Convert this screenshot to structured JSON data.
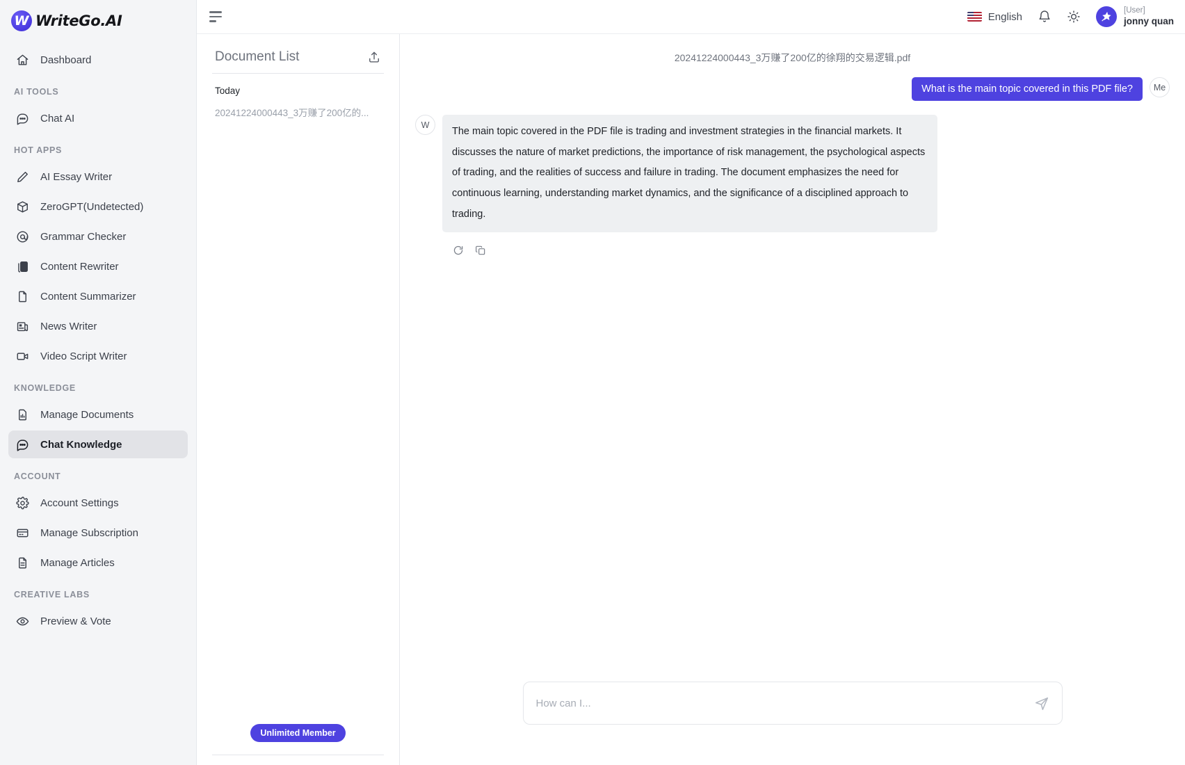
{
  "brand": {
    "mark": "W",
    "name": "WriteGo.AI",
    "logo_color": "#4e42e0"
  },
  "sidebar": {
    "groups": [
      {
        "label": "",
        "items": [
          {
            "label": "Dashboard",
            "icon": "home-icon",
            "key": "dashboard",
            "active": false
          }
        ]
      },
      {
        "label": "AI TOOLS",
        "items": [
          {
            "label": "Chat AI",
            "icon": "chat-bubble-icon",
            "key": "chat-ai",
            "active": false
          }
        ]
      },
      {
        "label": "HOT APPS",
        "items": [
          {
            "label": "AI Essay Writer",
            "icon": "pencil-icon",
            "key": "ai-essay-writer",
            "active": false
          },
          {
            "label": "ZeroGPT(Undetected)",
            "icon": "cube-icon",
            "key": "zerogpt-undetected",
            "active": false
          },
          {
            "label": "Grammar Checker",
            "icon": "at-circle-icon",
            "key": "grammar-checker",
            "active": false
          },
          {
            "label": "Content Rewriter",
            "icon": "copy-icon",
            "key": "content-rewriter",
            "active": false
          },
          {
            "label": "Content Summarizer",
            "icon": "document-icon",
            "key": "content-summarizer",
            "active": false
          },
          {
            "label": "News Writer",
            "icon": "newspaper-icon",
            "key": "news-writer",
            "active": false
          },
          {
            "label": "Video Script Writer",
            "icon": "video-camera-icon",
            "key": "video-script-writer",
            "active": false
          }
        ]
      },
      {
        "label": "KNOWLEDGE",
        "items": [
          {
            "label": "Manage Documents",
            "icon": "document-chart-icon",
            "key": "manage-documents",
            "active": false
          },
          {
            "label": "Chat Knowledge",
            "icon": "chat-bubble-icon",
            "key": "chat-knowledge",
            "active": true
          }
        ]
      },
      {
        "label": "ACCOUNT",
        "items": [
          {
            "label": "Account Settings",
            "icon": "gear-icon",
            "key": "account-settings",
            "active": false
          },
          {
            "label": "Manage Subscription",
            "icon": "credit-card-icon",
            "key": "manage-subscription",
            "active": false
          },
          {
            "label": "Manage Articles",
            "icon": "document-lines-icon",
            "key": "manage-articles",
            "active": false
          }
        ]
      },
      {
        "label": "CREATIVE LABS",
        "items": [
          {
            "label": "Preview & Vote",
            "icon": "eye-icon",
            "key": "preview-and-vote",
            "active": false
          }
        ]
      }
    ]
  },
  "topbar": {
    "menu_toggle": "hamburger-icon",
    "language": "English",
    "language_flag": "us-flag-icon",
    "notifications_icon": "bell-icon",
    "theme_icon": "sun-icon",
    "user": {
      "role": "[User]",
      "name": "jonny quan",
      "avatar_icon": "star-icon"
    }
  },
  "document_panel": {
    "title": "Document List",
    "upload_icon": "upload-icon",
    "group_label": "Today",
    "documents": [
      {
        "name": "20241224000443_3万赚了200亿的..."
      }
    ],
    "member_badge": "Unlimited Member"
  },
  "chat": {
    "filename": "20241224000443_3万赚了200亿的徐翔的交易逻辑.pdf",
    "messages": [
      {
        "role": "user",
        "avatar_label": "Me",
        "text": "What is the main topic covered in this PDF file?"
      },
      {
        "role": "assistant",
        "avatar_label": "W",
        "text": "The main topic covered in the PDF file is trading and investment strategies in the financial markets. It discusses the nature of market predictions, the importance of risk management, the psychological aspects of trading, and the realities of success and failure in trading. The document emphasizes the need for continuous learning, understanding market dynamics, and the significance of a disciplined approach to trading.",
        "actions": [
          {
            "icon": "refresh-icon",
            "name": "regenerate"
          },
          {
            "icon": "copy-icon",
            "name": "copy"
          }
        ]
      }
    ],
    "composer": {
      "placeholder": "How can I...",
      "value": "",
      "send_icon": "send-icon"
    }
  },
  "colors": {
    "accent": "#4e42e0",
    "sidebar_bg": "#f4f5f7",
    "bubble_ai_bg": "#eef0f2"
  }
}
